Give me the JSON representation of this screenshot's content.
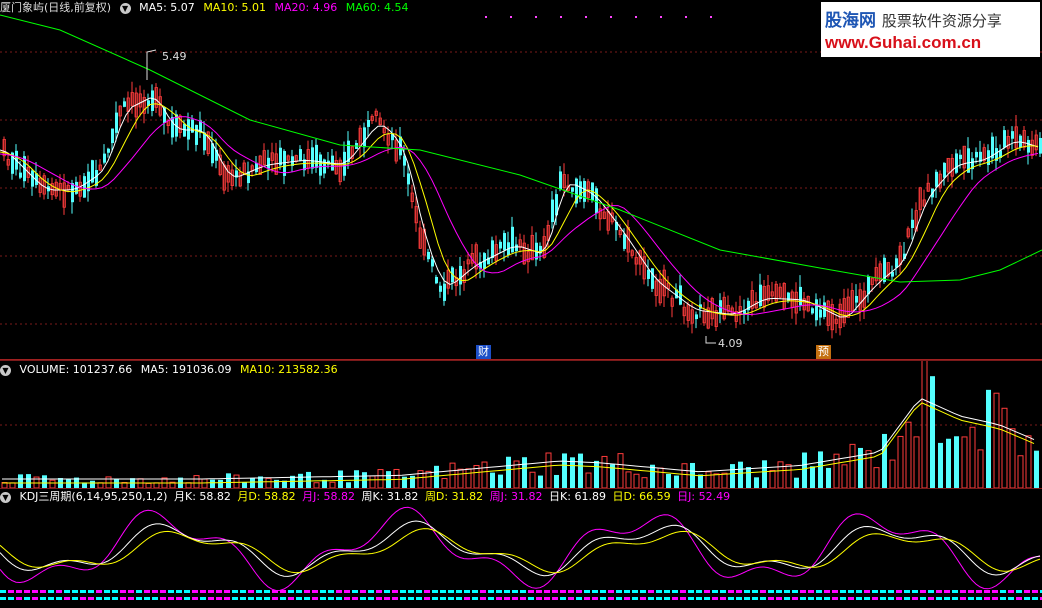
{
  "price_header": {
    "stock": "厦门象屿(日线,前复权)",
    "ma5": "MA5: 5.07",
    "ma10": "MA10: 5.01",
    "ma20": "MA20: 4.96",
    "ma60": "MA60: 4.54"
  },
  "price_annotations": {
    "high": "5.49",
    "low": "4.09",
    "tag_cai": "财",
    "tag_yu": "预"
  },
  "volume_header": {
    "volume": "VOLUME: 101237.66",
    "ma5": "MA5: 191036.09",
    "ma10": "MA10: 213582.36"
  },
  "kdj_header": {
    "name": "KDJ三周期(6,14,95,250,1,2)",
    "yk": "月K: 58.82",
    "yd": "月D: 58.82",
    "yj": "月J: 58.82",
    "zk": "周K: 31.82",
    "zd": "周D: 31.82",
    "zj": "周J: 31.82",
    "rk": "日K: 61.89",
    "rd": "日D: 66.59",
    "rj": "日J: 52.49"
  },
  "logo": {
    "brand": "股海网",
    "slogan": "股票软件资源分享",
    "url": "www.Guhai.com.cn"
  },
  "colors": {
    "up": "#ff3c3c",
    "down": "#54ffff",
    "ma5": "#ffffff",
    "ma10": "#ffff00",
    "ma20": "#ff00ff",
    "ma60": "#00ff00",
    "grid": "#7a1a1a"
  }
}
